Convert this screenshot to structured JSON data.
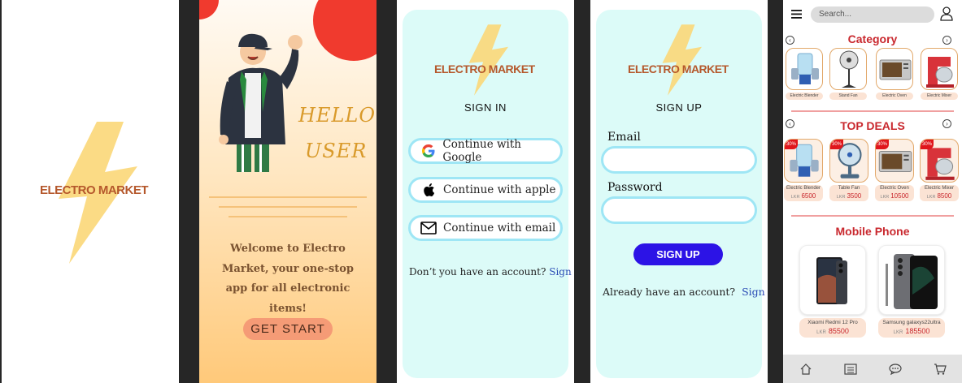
{
  "splash": {
    "brand": "ELECTRO MARKET"
  },
  "onboarding": {
    "hello_line1": "HELLO",
    "hello_line2": "USER",
    "welcome_text": "Welcome to Electro Market, your one-stop app for all electronic items!",
    "get_start_label": "GET START"
  },
  "signin": {
    "brand": "ELECTRO MARKET",
    "title": "SIGN IN",
    "google_label": "Continue with Google",
    "apple_label": "Continue with apple",
    "email_label": "Continue with email",
    "no_account_text": "Don’t you have an account?",
    "signup_link": "Sign up"
  },
  "signup": {
    "brand": "ELECTRO MARKET",
    "title": "SIGN UP",
    "email_label": "Email",
    "email_value": "",
    "password_label": "Password",
    "password_value": "",
    "button_label": "SIGN UP",
    "have_account_text": "Already have an account?",
    "signin_link": "Sign In"
  },
  "shop": {
    "search_placeholder": "Search...",
    "category_title": "Category",
    "categories": [
      {
        "label": "Electric Blender",
        "icon": "blender-icon"
      },
      {
        "label": "Stand Fan",
        "icon": "fan-icon"
      },
      {
        "label": "Electric Oven",
        "icon": "oven-icon"
      },
      {
        "label": "Electric Mixer",
        "icon": "mixer-icon"
      }
    ],
    "deals_title": "TOP DEALS",
    "deals": [
      {
        "badge": "30%",
        "name": "Electric Blender",
        "currency": "LKR",
        "price": "6500",
        "icon": "blender-icon"
      },
      {
        "badge": "30%",
        "name": "Table Fan",
        "currency": "LKR",
        "price": "3500",
        "icon": "fan-icon"
      },
      {
        "badge": "30%",
        "name": "Electric Oven",
        "currency": "LKR",
        "price": "10500",
        "icon": "oven-icon"
      },
      {
        "badge": "30%",
        "name": "Electric Mixer",
        "currency": "LKR",
        "price": "8500",
        "icon": "mixer-icon"
      }
    ],
    "mobile_title": "Mobile Phone",
    "phones": [
      {
        "name": "Xiaomi Redmi 12 Pro",
        "currency": "LKR",
        "price": "85500"
      },
      {
        "name": "Samsung galaxys22ultra",
        "currency": "LKR",
        "price": "185500"
      }
    ],
    "colors": {
      "accent": "#c9282e",
      "badge": "#e0161c",
      "signup_button": "#2c13e6"
    }
  }
}
